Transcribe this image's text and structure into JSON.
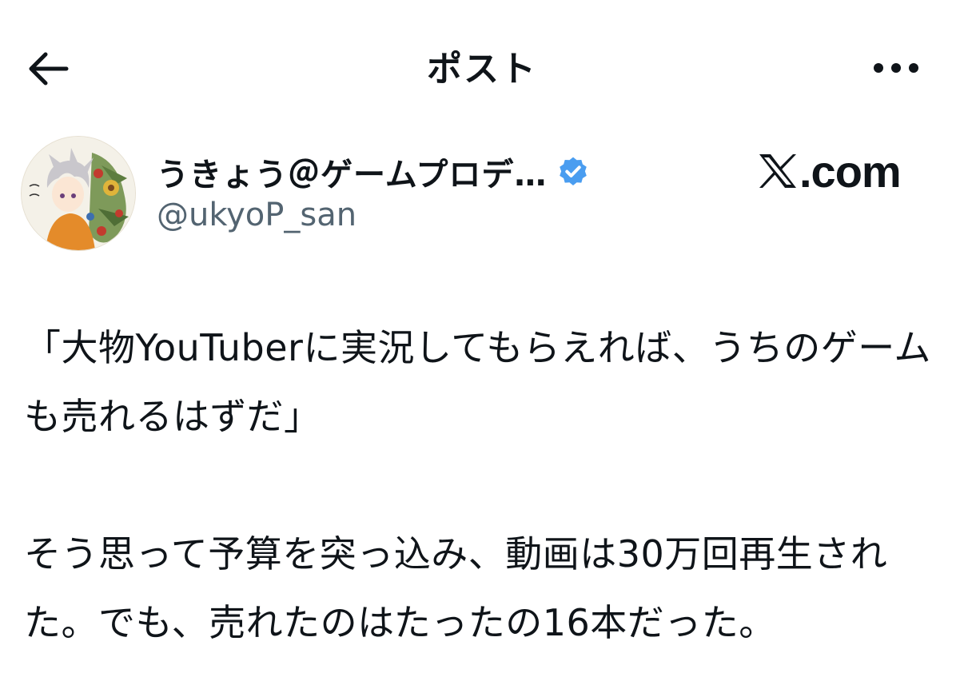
{
  "header": {
    "title": "ポスト",
    "back_icon": "arrow-left-icon",
    "more_icon": "more-horizontal-icon"
  },
  "author": {
    "display_name": "うきょう＠ゲームプロデ…",
    "handle": "@ukyoP_san",
    "verified": true,
    "verified_color": "#4a9df0"
  },
  "watermark": {
    "text": ".com",
    "logo_icon": "x-logo-icon"
  },
  "post": {
    "paragraphs": [
      "「大物YouTuberに実況してもらえれば、うちのゲームも売れるはずだ」",
      "そう思って予算を突っ込み、動画は30万回再生された。でも、売れたのはたったの16本だった。"
    ]
  }
}
